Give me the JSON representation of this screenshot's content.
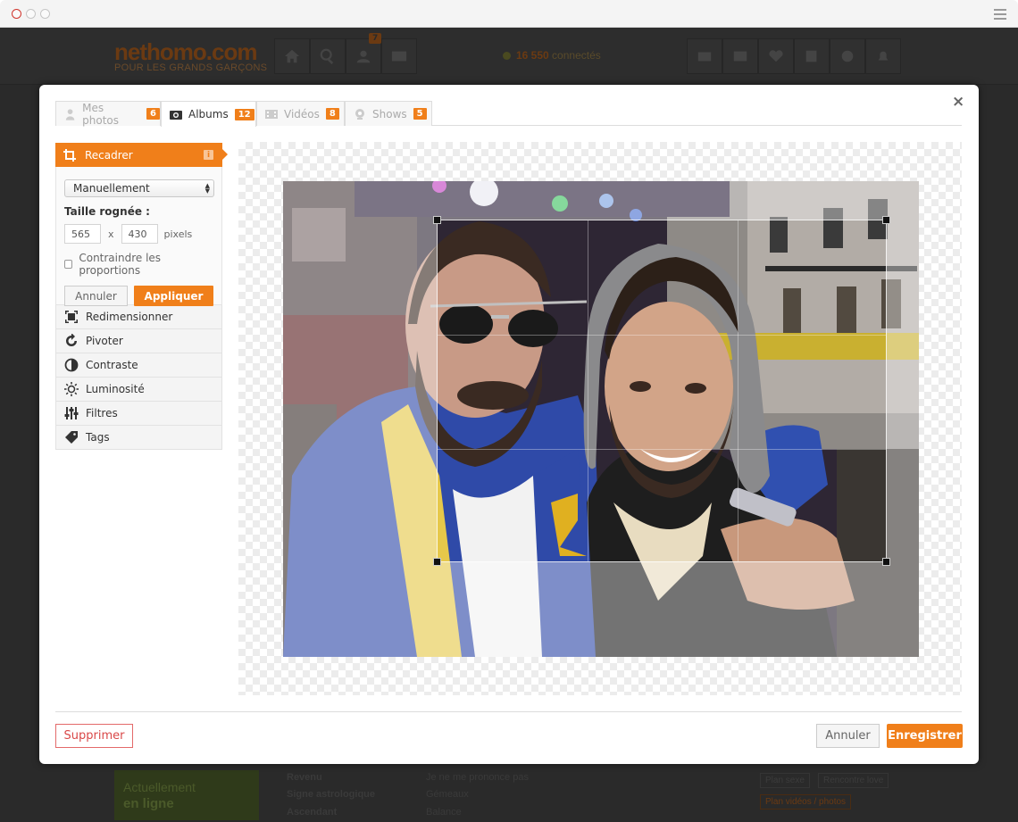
{
  "site": {
    "logo": "nethomo.com",
    "tagline": "POUR LES GRANDS GARÇONS",
    "nav_badge": "7",
    "online_count": "16 550",
    "online_label": "connectés",
    "online_side_line1": "Actuellement",
    "online_side_line2": "en ligne",
    "profile": [
      {
        "label": "Revenu",
        "value": "Je ne me prononce pas"
      },
      {
        "label": "Signe astrologique",
        "value": "Gémeaux"
      },
      {
        "label": "Ascendant",
        "value": "Balance"
      }
    ],
    "tags": [
      "Plan sexe",
      "Rencontre love",
      "Plan vidéos / photos"
    ]
  },
  "modal": {
    "close": "×",
    "tabs": [
      {
        "label": "Mes photos",
        "count": "6",
        "icon": "user-icon"
      },
      {
        "label": "Albums",
        "count": "12",
        "icon": "camera-icon"
      },
      {
        "label": "Vidéos",
        "count": "8",
        "icon": "film-icon"
      },
      {
        "label": "Shows",
        "count": "5",
        "icon": "webcam-icon"
      }
    ],
    "crop": {
      "title": "Recadrer",
      "info": "i",
      "mode": "Manuellement",
      "size_label": "Taille rognée :",
      "width": "565",
      "times": "x",
      "height": "430",
      "unit": "pixels",
      "constrain_label": "Contraindre les proportions",
      "cancel": "Annuler",
      "apply": "Appliquer"
    },
    "tools": [
      {
        "label": "Redimensionner",
        "icon": "resize-icon"
      },
      {
        "label": "Pivoter",
        "icon": "rotate-icon"
      },
      {
        "label": "Contraste",
        "icon": "contrast-icon"
      },
      {
        "label": "Luminosité",
        "icon": "brightness-icon"
      },
      {
        "label": "Filtres",
        "icon": "filters-icon"
      },
      {
        "label": "Tags",
        "icon": "tag-icon"
      }
    ],
    "footer": {
      "delete": "Supprimer",
      "cancel": "Annuler",
      "save": "Enregistrer"
    }
  },
  "colors": {
    "accent": "#f07f1a",
    "danger": "#d94848"
  }
}
